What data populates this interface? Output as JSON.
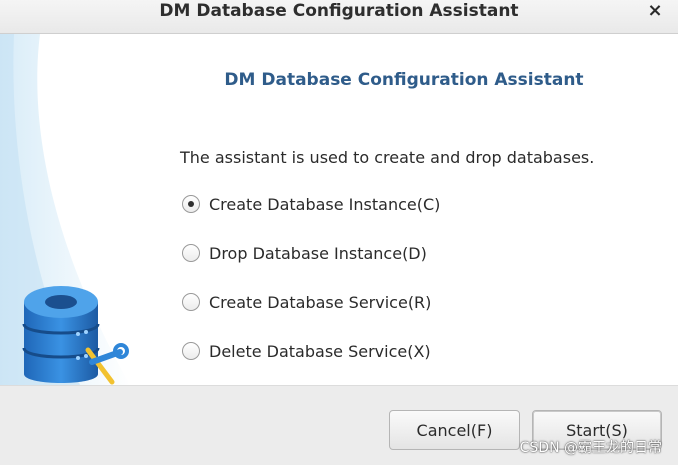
{
  "window": {
    "title": "DM Database Configuration Assistant",
    "close_glyph": "×"
  },
  "main": {
    "heading": "DM Database Configuration Assistant",
    "description": "The assistant is used to create and drop databases.",
    "options": [
      {
        "label": "Create Database Instance(C)",
        "checked": true
      },
      {
        "label": "Drop Database Instance(D)",
        "checked": false
      },
      {
        "label": "Create Database Service(R)",
        "checked": false
      },
      {
        "label": "Delete Database Service(X)",
        "checked": false
      }
    ]
  },
  "footer": {
    "cancel_label": "Cancel(F)",
    "start_label": "Start(S)"
  },
  "watermark": "CSDN @霸王龙的日常",
  "colors": {
    "heading": "#2f5c8a",
    "db_icon": "#2f86d8",
    "background": "#ffffff"
  },
  "icons": [
    "close-icon",
    "database-icon",
    "wrench-icon"
  ]
}
